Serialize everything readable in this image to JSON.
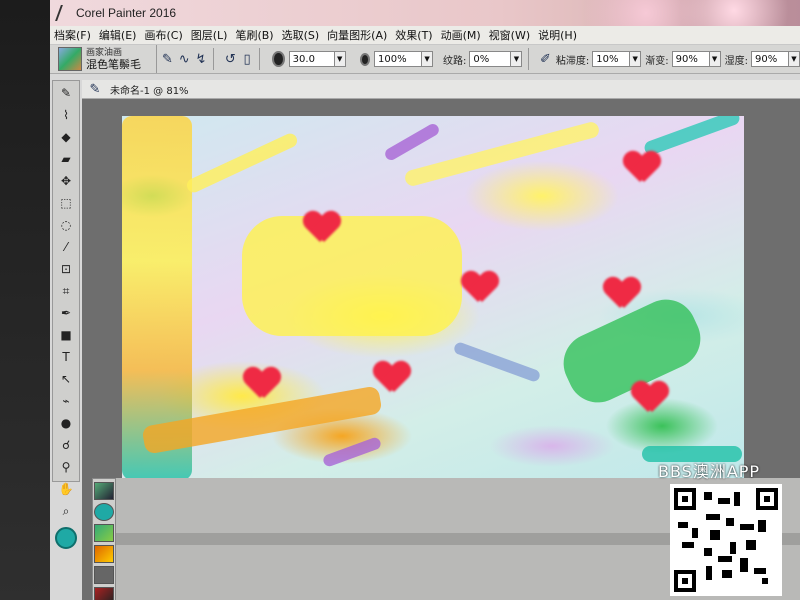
{
  "window": {
    "title": "Corel Painter 2016"
  },
  "menu": [
    "档案(F)",
    "编辑(E)",
    "画布(C)",
    "图层(L)",
    "笔刷(B)",
    "选取(S)",
    "向量图形(A)",
    "效果(T)",
    "动画(M)",
    "视窗(W)",
    "说明(H)"
  ],
  "property_bar": {
    "brush_category": "画家油画",
    "brush_variant": "混色笔鬃毛",
    "size_value": "30.0",
    "opacity_value": "100%",
    "grain_label": "纹路:",
    "grain_value": "0%",
    "viscosity_label": "粘滞度:",
    "viscosity_value": "10%",
    "blend_label": "渐变:",
    "blend_value": "90%",
    "wetness_label": "湿度:",
    "wetness_value": "90%"
  },
  "document": {
    "title": "未命名-1 @ 81%"
  },
  "watermark": {
    "title": "BBS澳洲APP"
  },
  "colors": {
    "accent": "#1fa9a5",
    "heart": "#ef2a44"
  },
  "toolbox": {
    "tools": [
      "brush-icon",
      "dropper-icon",
      "fill-icon",
      "eraser-icon",
      "move-icon",
      "rect-select-icon",
      "lasso-icon",
      "magic-wand-icon",
      "transform-icon",
      "crop-icon",
      "pen-icon",
      "rectangle-icon",
      "text-icon",
      "selection-icon",
      "path-icon",
      "dodge-icon",
      "blend-icon",
      "clone-icon",
      "hand-icon",
      "zoom-icon",
      "rotate-icon"
    ]
  }
}
